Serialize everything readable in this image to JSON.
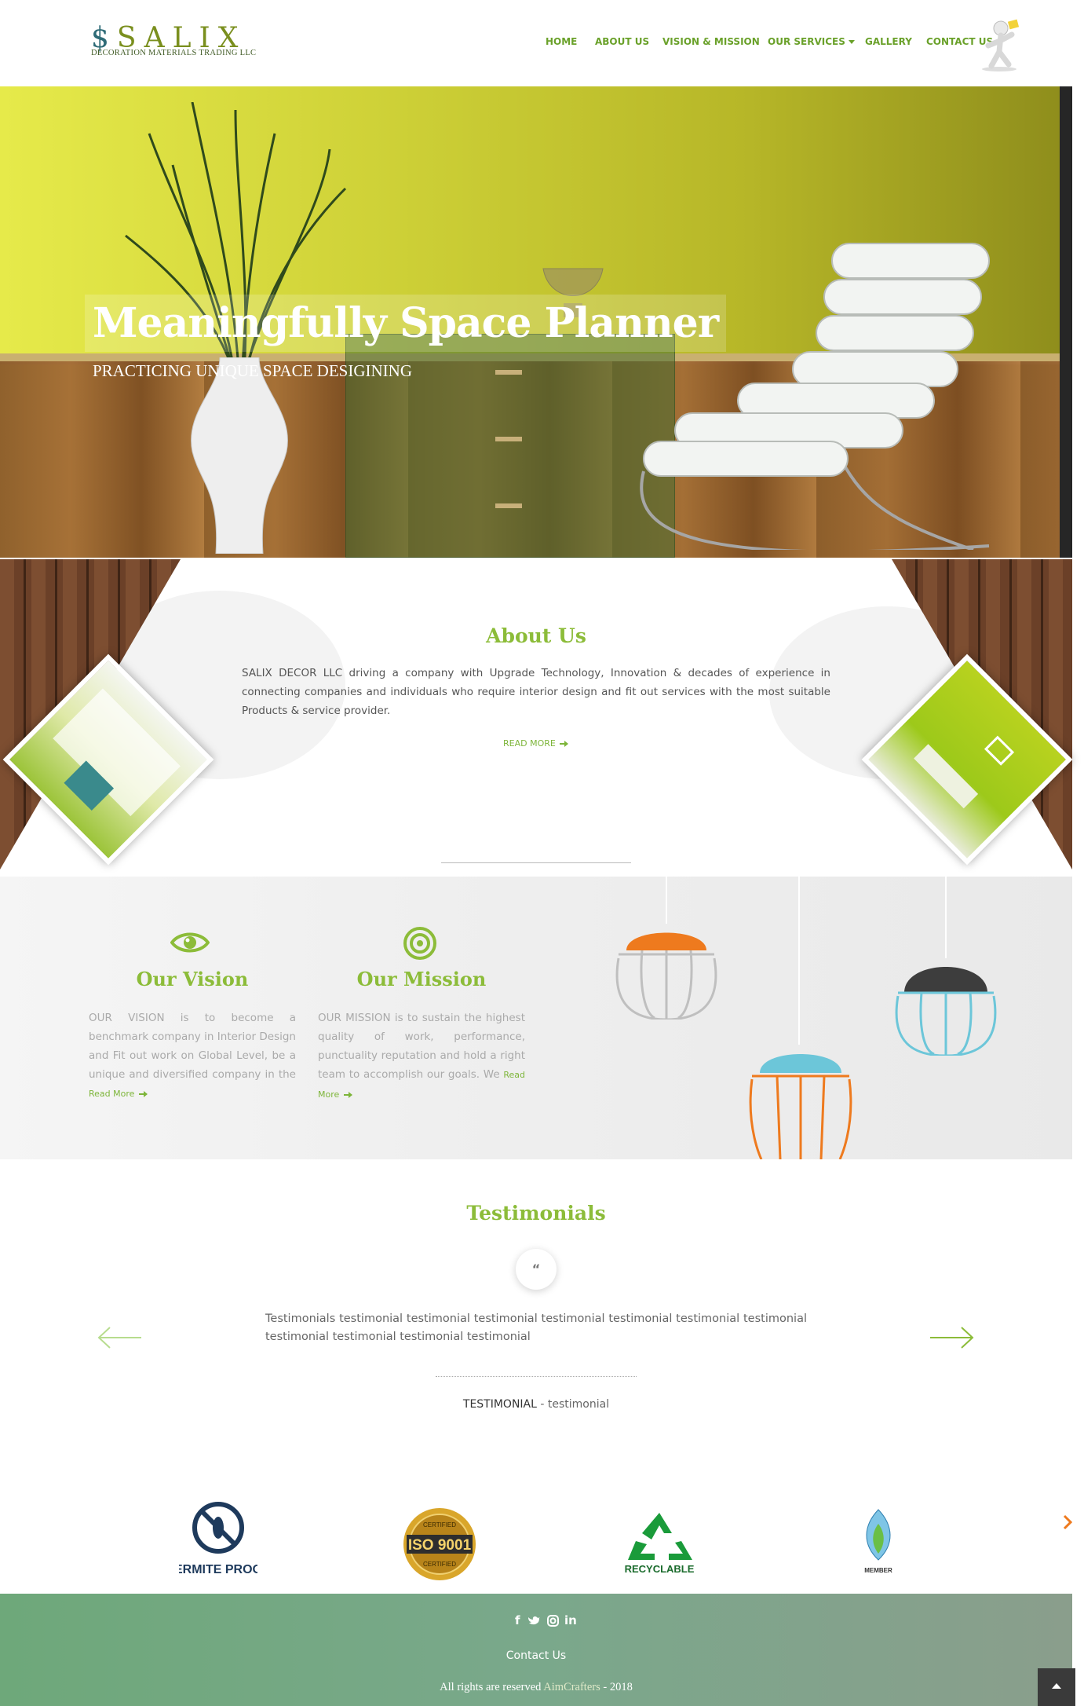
{
  "header": {
    "logo_word": "SALIX",
    "logo_sub": "DECORATION MATERIALS TRADING LLC",
    "nav": [
      "HOME",
      "ABOUT US",
      "VISION & MISSION",
      "OUR SERVICES",
      "GALLERY",
      "CONTACT US"
    ]
  },
  "hero": {
    "title": "Meaningfully Space Planner",
    "subtitle": "PRACTICING UNIQUE SPACE DESIGINING"
  },
  "about": {
    "title": "About Us",
    "text": "SALIX DECOR LLC driving a company with Upgrade Technology, Innovation & decades of experience in connecting companies and individuals who require interior design and fit out services with the most suitable Products & service provider.",
    "read_more": "READ MORE"
  },
  "vision": {
    "title": "Our Vision",
    "text": "OUR VISION is to become a benchmark company in Interior Design and Fit out work on Global Level, be a unique and diversified company in the",
    "read_more": "Read More"
  },
  "mission": {
    "title": "Our Mission",
    "text": "OUR MISSION is to sustain the highest quality of work, performance, punctuality reputation and hold a right team to accomplish our goals. We",
    "read_more": "Read More"
  },
  "testimonials": {
    "title": "Testimonials",
    "quote_icon": "“",
    "text": "Testimonials testimonial testimonial testimonial testimonial testimonial testimonial testimonial testimonial testimonial testimonial testimonial",
    "author": "TESTIMONIAL",
    "author_sep": " - ",
    "author_role": "testimonial"
  },
  "badges": {
    "termite": "TERMITE PROOF",
    "iso": "ISO 9001",
    "iso_top": "CERTIFIED",
    "iso_bottom": "CERTIFIED",
    "recycle": "RECYCLABLE",
    "member": "MEMBER"
  },
  "footer": {
    "social": [
      "f",
      "twitter-icon",
      "instagram-icon",
      "in"
    ],
    "contact": "Contact Us",
    "copy": "All rights are reserved",
    "brand": "AimCrafters",
    "year": " - 2018"
  },
  "colors": {
    "accent_green": "#8cbc39",
    "nav_green": "#6aa12a",
    "footer_green": "#6ea87a"
  }
}
